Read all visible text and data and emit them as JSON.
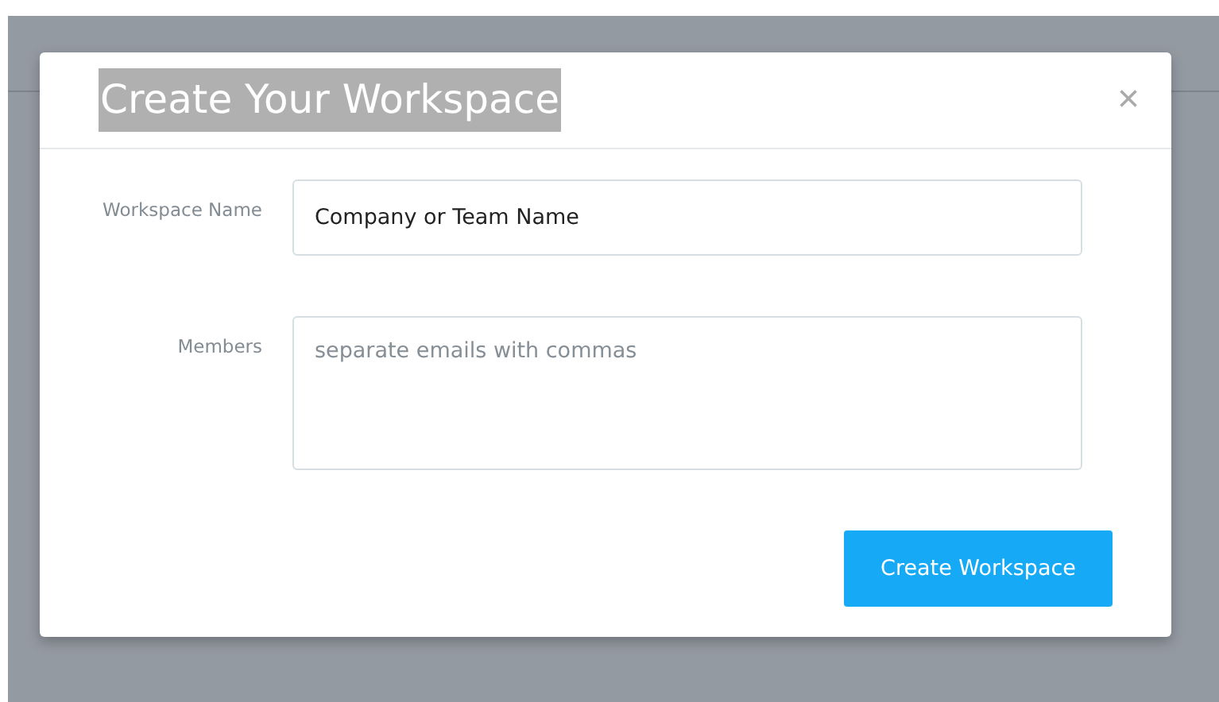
{
  "dialog": {
    "title": {
      "text": "Create Your Workspace",
      "highlighted": true
    },
    "close": "×",
    "fields": [
      {
        "kind": "input",
        "label": "Workspace Name",
        "value": "Company or Team Name"
      },
      {
        "kind": "textarea",
        "label": "Members",
        "placeholder": "separate emails with commas"
      }
    ],
    "submit": "Create Workspace"
  }
}
